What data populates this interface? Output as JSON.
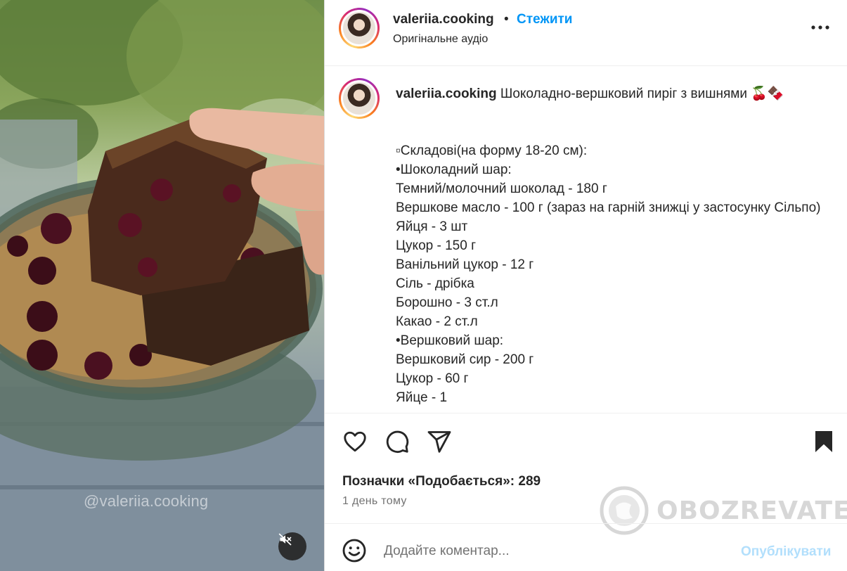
{
  "media": {
    "watermark": "@valeriia.cooking",
    "mute_icon": "speaker-muted-icon"
  },
  "header": {
    "username": "valeriia.cooking",
    "separator": "•",
    "follow_label": "Стежити",
    "audio_label": "Оригінальне аудіо",
    "more_icon": "more-dots-icon"
  },
  "caption": {
    "username": "valeriia.cooking",
    "title": "Шоколадно-вершковий пиріг з вишнями 🍒🍫",
    "lines": [
      "▫Складові(на форму 18-20 см):",
      "•Шоколадний шар:",
      "Темний/молочний шоколад - 180 г",
      "Вершкове масло - 100 г (зараз на гарній знижці у застосунку Сільпо)",
      "Яйця - 3 шт",
      "Цукор - 150 г",
      "Ванільний цукор - 12 г",
      "Сіль - дрібка",
      "Борошно - 3 ст.л",
      "Какао - 2 ст.л",
      "•Вершковий шар:",
      "Вершковий сир - 200 г",
      "Цукор - 60 г",
      "Яйце - 1"
    ]
  },
  "actions": {
    "likes_text": "Позначки «Подобається»: 289",
    "time_text": "1 день тому",
    "icons": [
      "heart-icon",
      "comment-icon",
      "share-icon",
      "bookmark-icon"
    ]
  },
  "brand": {
    "name": "OBOZREVATEL"
  },
  "comment": {
    "placeholder": "Додайте коментар...",
    "publish_label": "Опублікувати"
  },
  "colors": {
    "accent": "#0095f6",
    "publish_disabled": "#b2dffc",
    "text": "#262626",
    "muted": "#737373"
  }
}
